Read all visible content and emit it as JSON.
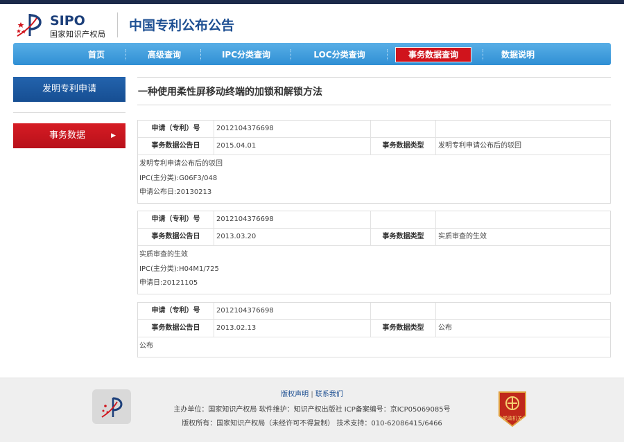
{
  "header": {
    "logo_en": "SIPO",
    "logo_cn": "国家知识产权局",
    "site_title": "中国专利公布公告"
  },
  "nav": [
    {
      "label": "首页"
    },
    {
      "label": "高级查询"
    },
    {
      "label": "IPC分类查询"
    },
    {
      "label": "LOC分类查询"
    },
    {
      "label": "事务数据查询",
      "active": true
    },
    {
      "label": "数据说明"
    }
  ],
  "sidebar": {
    "item1": "发明专利申请",
    "item2": "事务数据",
    "item2_arrow": "▶"
  },
  "main": {
    "title": "一种使用柔性屏移动终端的加锁和解锁方法",
    "records": [
      {
        "app_label": "申请（专利）号",
        "app_no": "2012104376698",
        "date_label": "事务数据公告日",
        "date": "2015.04.01",
        "type_label": "事务数据类型",
        "type": "发明专利申请公布后的驳回",
        "details": [
          "发明专利申请公布后的驳回",
          "IPC(主分类):G06F3/048",
          "申请公布日:20130213"
        ]
      },
      {
        "app_label": "申请（专利）号",
        "app_no": "2012104376698",
        "date_label": "事务数据公告日",
        "date": "2013.03.20",
        "type_label": "事务数据类型",
        "type": "实质审查的生效",
        "details": [
          "实质审查的生效",
          "IPC(主分类):H04M1/725",
          "申请日:20121105"
        ]
      },
      {
        "app_label": "申请（专利）号",
        "app_no": "2012104376698",
        "date_label": "事务数据公告日",
        "date": "2013.02.13",
        "type_label": "事务数据类型",
        "type": "公布",
        "details": [
          "公布"
        ]
      }
    ]
  },
  "footer": {
    "link1": "版权声明",
    "link_sep": "|",
    "link2": "联系我们",
    "line1": "主办单位：国家知识产权局    软件维护：知识产权出版社    ICP备案编号：京ICP05069085号",
    "line2": "版权所有：国家知识产权局（未经许可不得复制）    技术支持：010-62086415/6466",
    "badge_text": "党政机关"
  },
  "colors": {
    "nav_blue": "#3a9ad9",
    "active_red": "#d0141c",
    "sidebar_blue": "#1d5aa0",
    "title_blue": "#1d4f92"
  }
}
